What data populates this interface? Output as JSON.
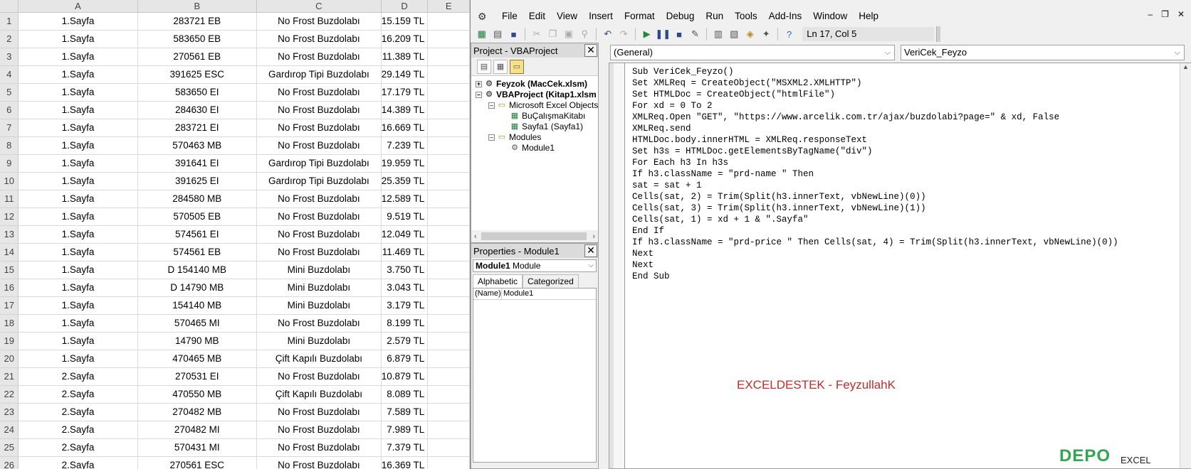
{
  "sheet": {
    "columns": [
      "A",
      "B",
      "C",
      "D",
      "E"
    ],
    "rows": [
      {
        "num": "1",
        "a": "1.Sayfa",
        "b": "283721 EB",
        "c": "No Frost Buzdolabı",
        "d": "15.159 TL"
      },
      {
        "num": "2",
        "a": "1.Sayfa",
        "b": "583650 EB",
        "c": "No Frost Buzdolabı",
        "d": "16.209 TL"
      },
      {
        "num": "3",
        "a": "1.Sayfa",
        "b": "270561 EB",
        "c": "No Frost Buzdolabı",
        "d": "11.389 TL"
      },
      {
        "num": "4",
        "a": "1.Sayfa",
        "b": "391625 ESC",
        "c": "Gardırop Tipi Buzdolabı",
        "d": "29.149 TL"
      },
      {
        "num": "5",
        "a": "1.Sayfa",
        "b": "583650 EI",
        "c": "No Frost Buzdolabı",
        "d": "17.179 TL"
      },
      {
        "num": "6",
        "a": "1.Sayfa",
        "b": "284630 EI",
        "c": "No Frost Buzdolabı",
        "d": "14.389 TL"
      },
      {
        "num": "7",
        "a": "1.Sayfa",
        "b": "283721 EI",
        "c": "No Frost Buzdolabı",
        "d": "16.669 TL"
      },
      {
        "num": "8",
        "a": "1.Sayfa",
        "b": "570463 MB",
        "c": "No Frost Buzdolabı",
        "d": "7.239 TL"
      },
      {
        "num": "9",
        "a": "1.Sayfa",
        "b": "391641 EI",
        "c": "Gardırop Tipi Buzdolabı",
        "d": "19.959 TL"
      },
      {
        "num": "10",
        "a": "1.Sayfa",
        "b": "391625 EI",
        "c": "Gardırop Tipi Buzdolabı",
        "d": "25.359 TL"
      },
      {
        "num": "11",
        "a": "1.Sayfa",
        "b": "284580 MB",
        "c": "No Frost Buzdolabı",
        "d": "12.589 TL"
      },
      {
        "num": "12",
        "a": "1.Sayfa",
        "b": "570505 EB",
        "c": "No Frost Buzdolabı",
        "d": "9.519 TL"
      },
      {
        "num": "13",
        "a": "1.Sayfa",
        "b": "574561 EI",
        "c": "No Frost Buzdolabı",
        "d": "12.049 TL"
      },
      {
        "num": "14",
        "a": "1.Sayfa",
        "b": "574561 EB",
        "c": "No Frost Buzdolabı",
        "d": "11.469 TL"
      },
      {
        "num": "15",
        "a": "1.Sayfa",
        "b": "D 154140 MB",
        "c": "Mini Buzdolabı",
        "d": "3.750 TL"
      },
      {
        "num": "16",
        "a": "1.Sayfa",
        "b": "D 14790 MB",
        "c": "Mini Buzdolabı",
        "d": "3.043 TL"
      },
      {
        "num": "17",
        "a": "1.Sayfa",
        "b": "154140 MB",
        "c": "Mini Buzdolabı",
        "d": "3.179 TL"
      },
      {
        "num": "18",
        "a": "1.Sayfa",
        "b": "570465 MI",
        "c": "No Frost Buzdolabı",
        "d": "8.199 TL"
      },
      {
        "num": "19",
        "a": "1.Sayfa",
        "b": "14790 MB",
        "c": "Mini Buzdolabı",
        "d": "2.579 TL"
      },
      {
        "num": "20",
        "a": "1.Sayfa",
        "b": "470465 MB",
        "c": "Çift Kapılı Buzdolabı",
        "d": "6.879 TL"
      },
      {
        "num": "21",
        "a": "2.Sayfa",
        "b": "270531 EI",
        "c": "No Frost Buzdolabı",
        "d": "10.879 TL"
      },
      {
        "num": "22",
        "a": "2.Sayfa",
        "b": "470550 MB",
        "c": "Çift Kapılı Buzdolabı",
        "d": "8.089 TL"
      },
      {
        "num": "23",
        "a": "2.Sayfa",
        "b": "270482 MB",
        "c": "No Frost Buzdolabı",
        "d": "7.589 TL"
      },
      {
        "num": "24",
        "a": "2.Sayfa",
        "b": "270482 MI",
        "c": "No Frost Buzdolabı",
        "d": "7.989 TL"
      },
      {
        "num": "25",
        "a": "2.Sayfa",
        "b": "570431 MI",
        "c": "No Frost Buzdolabı",
        "d": "7.379 TL"
      },
      {
        "num": "26",
        "a": "2.Sayfa",
        "b": "270561 ESC",
        "c": "No Frost Buzdolabı",
        "d": "16.369 TL"
      }
    ]
  },
  "vbe": {
    "menu": [
      "File",
      "Edit",
      "View",
      "Insert",
      "Format",
      "Debug",
      "Run",
      "Tools",
      "Add-Ins",
      "Window",
      "Help"
    ],
    "cursor_pos": "Ln 17, Col 5",
    "project": {
      "title": "Project - VBAProject",
      "nodes": {
        "feyzok": "Feyzok (MacCek.xlsm)",
        "vbaproject": "VBAProject (Kitap1.xlsm",
        "excel_objects": "Microsoft Excel Objects",
        "workbook": "BuÇalışmaKitabı",
        "sheet1": "Sayfa1 (Sayfa1)",
        "modules": "Modules",
        "module1": "Module1"
      }
    },
    "properties": {
      "title": "Properties - Module1",
      "object_bold": "Module1",
      "object_type": "Module",
      "tabs": [
        "Alphabetic",
        "Categorized"
      ],
      "name_key": "(Name)",
      "name_value": "Module1"
    },
    "code": {
      "object_combo": "(General)",
      "proc_combo": "VeriCek_Feyzo",
      "lines": [
        "Sub VeriCek_Feyzo()",
        "Set XMLReq = CreateObject(\"MSXML2.XMLHTTP\")",
        "Set HTMLDoc = CreateObject(\"htmlFile\")",
        "For xd = 0 To 2",
        "XMLReq.Open \"GET\", \"https://www.arcelik.com.tr/ajax/buzdolabi?page=\" & xd, False",
        "XMLReq.send",
        "HTMLDoc.body.innerHTML = XMLReq.responseText",
        "Set h3s = HTMLDoc.getElementsByTagName(\"div\")",
        "For Each h3 In h3s",
        "If h3.className = \"prd-name \" Then",
        "sat = sat + 1",
        "Cells(sat, 2) = Trim(Split(h3.innerText, vbNewLine)(0))",
        "Cells(sat, 3) = Trim(Split(h3.innerText, vbNewLine)(1))",
        "Cells(sat, 1) = xd + 1 & \".Sayfa\"",
        "End If",
        "If h3.className = \"prd-price \" Then Cells(sat, 4) = Trim(Split(h3.innerText, vbNewLine)(0))",
        "Next",
        "Next",
        "End Sub"
      ]
    }
  },
  "watermark": "EXCELDESTEK - FeyzullahK",
  "corner_logo": "DEPO",
  "corner_logo_small": "EXCEL"
}
